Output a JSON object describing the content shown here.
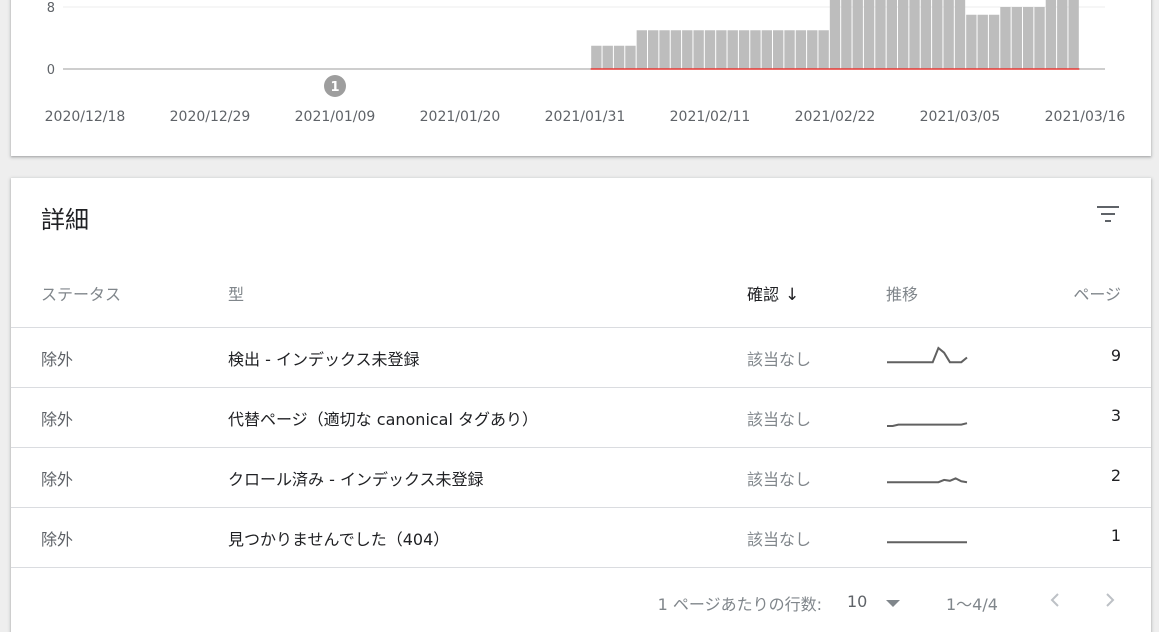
{
  "chart": {
    "y_ticks": [
      "8",
      "0"
    ],
    "x_ticks": [
      "2020/12/18",
      "2020/12/29",
      "2021/01/09",
      "2021/01/20",
      "2021/01/31",
      "2021/02/11",
      "2021/02/22",
      "2021/03/05",
      "2021/03/16"
    ],
    "annotation_label": "1",
    "colors": {
      "bar": "#bdbdbd",
      "line": "#e53935",
      "axis": "#9e9e9e",
      "grid": "#eeeeee",
      "annotation": "#9e9e9e"
    }
  },
  "chart_data": {
    "type": "bar",
    "x_start": "2020/12/18",
    "x_end": "2021/03/16",
    "x_ticks": [
      "2020/12/18",
      "2020/12/29",
      "2021/01/09",
      "2021/01/20",
      "2021/01/31",
      "2021/02/11",
      "2021/02/22",
      "2021/03/05",
      "2021/03/16"
    ],
    "annotation": {
      "date": "2021/01/09",
      "label": "1"
    },
    "series": [
      {
        "dates": [
          "2021/02/01",
          "2021/02/02",
          "2021/02/03",
          "2021/02/04",
          "2021/02/05",
          "2021/02/06",
          "2021/02/07",
          "2021/02/08",
          "2021/02/09",
          "2021/02/10",
          "2021/02/11",
          "2021/02/12",
          "2021/02/13",
          "2021/02/14",
          "2021/02/15",
          "2021/02/16",
          "2021/02/17",
          "2021/02/18",
          "2021/02/19",
          "2021/02/20",
          "2021/02/21",
          "2021/02/22",
          "2021/02/23",
          "2021/02/24",
          "2021/02/25",
          "2021/02/26",
          "2021/02/27",
          "2021/02/28",
          "2021/03/01",
          "2021/03/02",
          "2021/03/03",
          "2021/03/04",
          "2021/03/05",
          "2021/03/06",
          "2021/03/07",
          "2021/03/08",
          "2021/03/09",
          "2021/03/10",
          "2021/03/11",
          "2021/03/12",
          "2021/03/13",
          "2021/03/14",
          "2021/03/15"
        ],
        "values": [
          3,
          3,
          3,
          3,
          5,
          5,
          5,
          5,
          5,
          5,
          5,
          5,
          5,
          5,
          5,
          5,
          5,
          5,
          5,
          5,
          5,
          9,
          9,
          9,
          9,
          9,
          9,
          9,
          9,
          9,
          9,
          9,
          9,
          7,
          7,
          7,
          8,
          8,
          8,
          8,
          9,
          9,
          9
        ]
      },
      {
        "dates": [
          "2021/02/01",
          "2021/03/16"
        ],
        "values": [
          0,
          0
        ]
      }
    ],
    "ylim": [
      0,
      9
    ],
    "grid": true
  },
  "details": {
    "title": "詳細",
    "filter_icon": "filter-list-icon",
    "columns": {
      "status": "ステータス",
      "type": "型",
      "verify": "確認",
      "trend": "推移",
      "pages": "ページ"
    },
    "sort_icon": "arrow-down-icon",
    "rows": [
      {
        "status": "除外",
        "type": "検出 - インデックス未登録",
        "verify": "該当なし",
        "pages": "9",
        "trend": [
          1,
          1,
          1,
          1,
          1,
          1,
          1,
          1,
          1,
          4,
          3,
          1,
          1,
          1,
          2
        ]
      },
      {
        "status": "除外",
        "type": "代替ページ（適切な canonical タグあり）",
        "verify": "該当なし",
        "pages": "3",
        "trend": [
          0.2,
          0.2,
          0.5,
          0.5,
          0.5,
          0.5,
          0.5,
          0.5,
          0.5,
          0.5,
          0.5,
          0.5,
          0.5,
          0.5,
          0.8
        ]
      },
      {
        "status": "除外",
        "type": "クロール済み - インデックス未登録",
        "verify": "該当なし",
        "pages": "2",
        "trend": [
          1,
          1,
          1,
          1,
          1,
          1,
          1,
          1,
          1,
          1,
          1.5,
          1.3,
          1.8,
          1.2,
          1
        ]
      },
      {
        "status": "除外",
        "type": "見つかりませんでした（404）",
        "verify": "該当なし",
        "pages": "1",
        "trend": [
          1,
          1,
          1,
          1,
          1,
          1,
          1,
          1,
          1,
          1,
          1,
          1,
          1,
          1,
          1
        ]
      }
    ],
    "trend_color": "#616161"
  },
  "pagination": {
    "rows_label": "1 ページあたりの行数:",
    "rows_value": "10",
    "range": "1～4/4",
    "prev_icon": "chevron-left-icon",
    "next_icon": "chevron-right-icon"
  }
}
